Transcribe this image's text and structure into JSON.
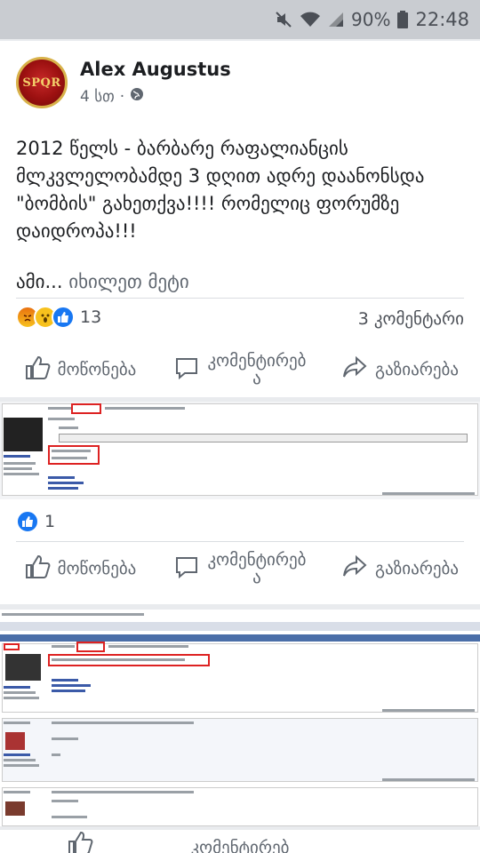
{
  "status_bar": {
    "battery": "90%",
    "time": "22:48"
  },
  "post": {
    "author": "Alex Augustus",
    "avatar_text": "SPQR",
    "time": "4 სთ",
    "text": "2012 წელს - ბარბარე რაფალიანცის მლკვლელობამდე 3 დღით ადრე დაანონსდა  \"ბომბის\" გახეთქვა!!!! რომელიც ფორუმზე დაიდროპა!!!",
    "text_end": "ამი...",
    "see_more": "იხილეთ მეტი",
    "reaction_count": "13",
    "comments_count": "3 კომენტარი"
  },
  "actions": {
    "like": "მოწონება",
    "comment": "კომენტირებ\nა",
    "share": "გაზიარება"
  },
  "image_post_1": {
    "reaction_count": "1"
  },
  "image_post_2": {
    "comment_partial": "კომენტირებ"
  }
}
